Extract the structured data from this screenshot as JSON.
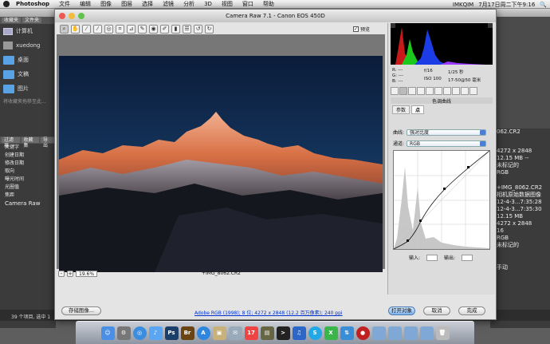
{
  "menubar": {
    "app": "Photoshop",
    "items": [
      "文件",
      "编辑",
      "图像",
      "图层",
      "选择",
      "滤镜",
      "分析",
      "3D",
      "视图",
      "窗口",
      "帮助"
    ],
    "right": [
      "IMKQIM",
      "7月17日周二下午9:16"
    ]
  },
  "bridge_left": {
    "tabs": [
      "收藏夹",
      "文件夹"
    ],
    "favorites": [
      {
        "label": "计算机",
        "icon": "computer-icon"
      },
      {
        "label": "xuedong",
        "icon": "home-icon"
      },
      {
        "label": "桌面",
        "icon": "folder-icon"
      },
      {
        "label": "文稿",
        "icon": "folder-icon"
      },
      {
        "label": "图片",
        "icon": "folder-icon"
      }
    ],
    "drag_hint": "将收藏夹拖移至此...",
    "filter_tabs": [
      "过滤器",
      "收藏集",
      "导出"
    ],
    "keywords": [
      "关键字",
      "创建日期",
      "修改日期",
      "取向",
      "曝光时间",
      "光圈值",
      "焦距",
      "Camera Raw"
    ]
  },
  "bridge_right": {
    "meta": [
      "4272 x 2848",
      "12.15 MB --",
      "未标记的",
      "RGB"
    ],
    "meta2": [
      "+IMG_8062.CR2",
      "相机原始数据图像",
      "12-4-3...7:35:28",
      "12-4-3...7:35:30",
      "12.15 MB",
      "4272 x 2848",
      "16",
      "RGB",
      "未标记的"
    ],
    "partial_name": "062.CR2",
    "action": "手动"
  },
  "bridge_bottom": {
    "status": "39 个项目, 选中 1"
  },
  "camera_raw": {
    "title": "Camera Raw 7.1 - Canon EOS 450D",
    "preview_label": "预览",
    "zoom": "19.6%",
    "filename": "+IMG_8062.CR2",
    "readout": {
      "r": "R: ---",
      "g": "G: ---",
      "b": "B: ---",
      "aperture": "f/16",
      "shutter": "1/25 秒",
      "iso": "ISO 100",
      "lens": "17-50@50 毫米"
    },
    "section_title": "色调曲线",
    "subtabs": [
      "参数",
      "点"
    ],
    "curve_label": "曲线:",
    "curve_value": "强对比度",
    "channel_label": "通道:",
    "channel_value": "RGB",
    "input_label": "输入:",
    "output_label": "输出:",
    "buttons": {
      "save": "存储图像...",
      "workflow": "Adobe RGB (1998); 8 位; 4272 x 2848 (12.2 百万像素); 240 ppi",
      "open": "打开对象",
      "cancel": "取消",
      "done": "完成"
    }
  },
  "dock": {
    "icons": [
      "finder",
      "system-prefs",
      "safari",
      "itunes",
      "photoshop",
      "bridge",
      "app-store",
      "preview",
      "mail",
      "calendar",
      "photo",
      "terminal",
      "music",
      "skype",
      "x",
      "vs",
      "red-app",
      "folder-1",
      "folder-2",
      "folder-3",
      "folder-4",
      "trash"
    ]
  }
}
